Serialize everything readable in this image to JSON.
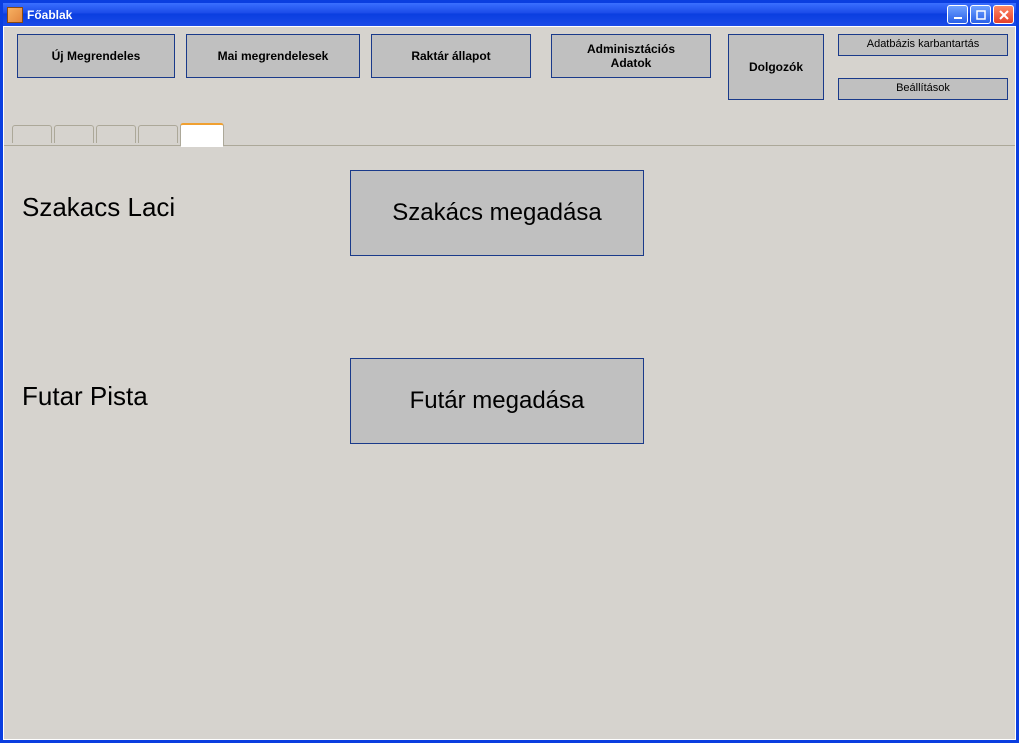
{
  "window": {
    "title": "Főablak"
  },
  "toolbar": {
    "new_order": "Új Megrendeles",
    "todays_orders": "Mai megrendelesek",
    "stock_status": "Raktár állapot",
    "admin_data": "Adminisztációs\nAdatok",
    "employees": "Dolgozók",
    "db_maint": "Adatbázis karbantartás",
    "settings": "Beállítások"
  },
  "page": {
    "cook_name": "Szakacs Laci",
    "courier_name": "Futar Pista",
    "set_cook_btn": "Szakács megadása",
    "set_courier_btn": "Futár megadása"
  }
}
